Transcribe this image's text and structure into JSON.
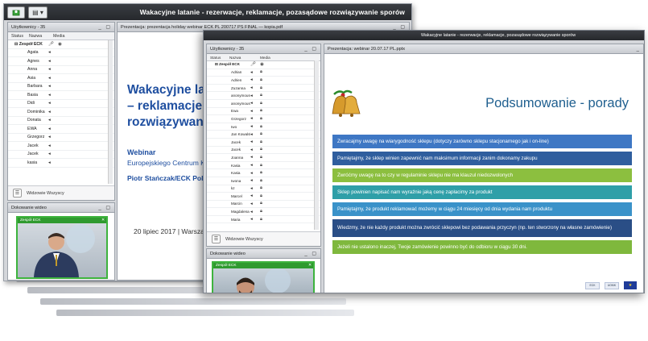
{
  "window_back": {
    "title": "Wakacyjne latanie - rezerwacje, reklamacje, pozasądowe rozwiązywanie sporów",
    "users_panel": {
      "title": "Użytkownicy - 35",
      "columns": [
        "Status",
        "Nazwa",
        "Media"
      ],
      "group": "Zespół ECK",
      "users": [
        "Agata",
        "Agnes",
        "Anna",
        "Asia",
        "Barbara",
        "Basia",
        "Didi",
        "Dominika",
        "Donata",
        "EWA",
        "Grzegorz",
        "Jacek",
        "Jacek",
        "kasia"
      ],
      "footer": "Widzowie Wszyscy"
    },
    "video_panel": {
      "title": "Dokowanie wideo",
      "label": "Zespół ECK"
    },
    "presentation_panel": {
      "title": "Prezentacja: prezentacja holiday webinar ECK PL 200717 PS FINAL — kopia.pdf",
      "slide": {
        "title_line1": "Wakacyjne latar",
        "title_line2": "– reklamacje, po",
        "title_line3a": "rozwiązywanie ",
        "title_line3b": "s",
        "webinar": "Webinar",
        "org": "Europejskiego Centrum Ko",
        "author": "Piotr Stańczak/ECK Polska",
        "date": "20 lipiec 2017 | Warszaw"
      }
    }
  },
  "window_front": {
    "title": "Wakacyjne latanie - rezerwacje, reklamacje, pozasądowe rozwiązywanie sporów",
    "users_panel": {
      "title": "Użytkownicy - 35",
      "columns": [
        "Status",
        "Nazwa",
        "Media"
      ],
      "group": "Zespół ECK",
      "users": [
        "Adrian",
        "Adrien",
        "Zuzanna",
        "anonymous",
        "anonymous",
        "Ewa",
        "Grzegorz",
        "Iwo",
        "Jan Kowalski",
        "Jacek",
        "Jacek",
        "Joanna",
        "Kasia",
        "Kasia",
        "Iwona",
        "kz",
        "Marcel",
        "Marcin",
        "Magdalena",
        "Maria"
      ],
      "footer": "Widzowie Wszyscy"
    },
    "video_panel": {
      "title": "Dokowanie wideo",
      "label": "Zespół ECK"
    },
    "presentation_panel": {
      "title": "Prezentacja: webinar 20.07.17 PL.pptx",
      "slide": {
        "title": "Podsumowanie - porady",
        "tips": [
          {
            "text": "Zwracajmy uwagę na wiarygodność sklepu (dotyczy zarówno sklepu stacjonarnego jak i on-line)",
            "color": "#3e77c4"
          },
          {
            "text": "Pamiętajmy, że sklep winien zapewnić nam maksimum informacji zanim dokonamy zakupu",
            "color": "#2f5e9e"
          },
          {
            "text": "Zwróćmy uwagę na to czy w regulaminie sklepu nie ma klauzul niedozwolonych",
            "color": "#8cbf3f"
          },
          {
            "text": "Sklep powinien napisać nam wyraźnie jaką cenę zapłacimy za produkt",
            "color": "#2f9fa8"
          },
          {
            "text": "Pamiętajmy, że produkt reklamować możemy w ciągu 24 miesięcy od dnia wydania nam produktu",
            "color": "#3a92c9"
          },
          {
            "text": "Wiedzmy, że nie każdy produkt można zwrócić sklepowi bez podawania przyczyn (np. ten stworzony na własne zamówienie)",
            "color": "#2a4e86"
          },
          {
            "text": "Jeżeli nie ustalono inaczej, Twoje zamówienie powinno być do odbioru w ciągu 30 dni.",
            "color": "#7fb83d"
          }
        ]
      }
    }
  }
}
